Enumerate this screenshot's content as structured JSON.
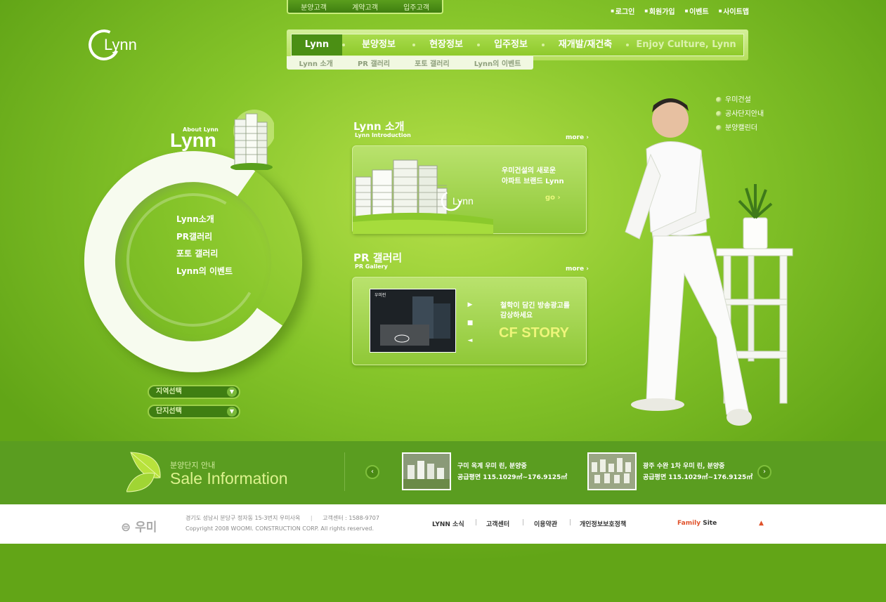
{
  "top_tabs": [
    "분양고객",
    "계약고객",
    "입주고객"
  ],
  "util_links": [
    "로그인",
    "회원가입",
    "이벤트",
    "사이트맵"
  ],
  "logo": {
    "text": "Lynn"
  },
  "gnb": {
    "items": [
      "Lynn",
      "분양정보",
      "현장정보",
      "입주정보",
      "재개발/재건축",
      "Enjoy Culture, Lynn"
    ],
    "active": "Lynn"
  },
  "subnav": [
    "Lynn 소개",
    "PR 갤러리",
    "포토 갤러리",
    "Lynn의 이벤트"
  ],
  "about": {
    "small": "About Lynn",
    "big": "Lynn",
    "menu": [
      "Lynn소개",
      "PR갤러리",
      "포토 갤러리",
      "Lynn의 이벤트"
    ],
    "selects": [
      "지역선택",
      "단지선택"
    ]
  },
  "intro": {
    "title": "Lynn 소개",
    "subtitle": "Lynn Introduction",
    "more": "more ›",
    "line1": "우미건설의 새로운",
    "line2": "아파트 브랜드 Lynn",
    "go": "go ›",
    "img_logo": "Lynn"
  },
  "pr": {
    "title": "PR 갤러리",
    "subtitle": "PR Gallery",
    "more": "more ›",
    "video_label": "우미린",
    "line1": "철학이 담긴 방송광고를",
    "line2": "감상하세요",
    "cf": "CF STORY"
  },
  "right_links": [
    "우미건설",
    "공사단지안내",
    "분양캘린더"
  ],
  "sale": {
    "small": "분양단지 안내",
    "big": "Sale Information",
    "items": [
      {
        "name": "구미 옥계 우미 린, 분양중",
        "area": "공급평면 115.1029㎡~176.9125㎡"
      },
      {
        "name": "광주 수완 1차 우미 린, 분양중",
        "area": "공급평면 115.1029㎡~176.9125㎡"
      }
    ]
  },
  "footer": {
    "logo": "우미",
    "address": "경기도 성남시 분당구 정자동 15-3번지 우미사옥",
    "center": "고객센터 : 1588-9707",
    "copyright": "Copyright 2008  WOOMI. CONSTRUCTION CORP. All rights reserved.",
    "links": [
      "LYNN 소식",
      "고객센터",
      "이용약관",
      "개인정보보호정책"
    ],
    "family_a": "Family",
    "family_b": " Site"
  },
  "colors": {
    "accent": "#8fca2c",
    "dark": "#4b8f14",
    "cf": "#eef57a",
    "family": "#e0522b"
  }
}
